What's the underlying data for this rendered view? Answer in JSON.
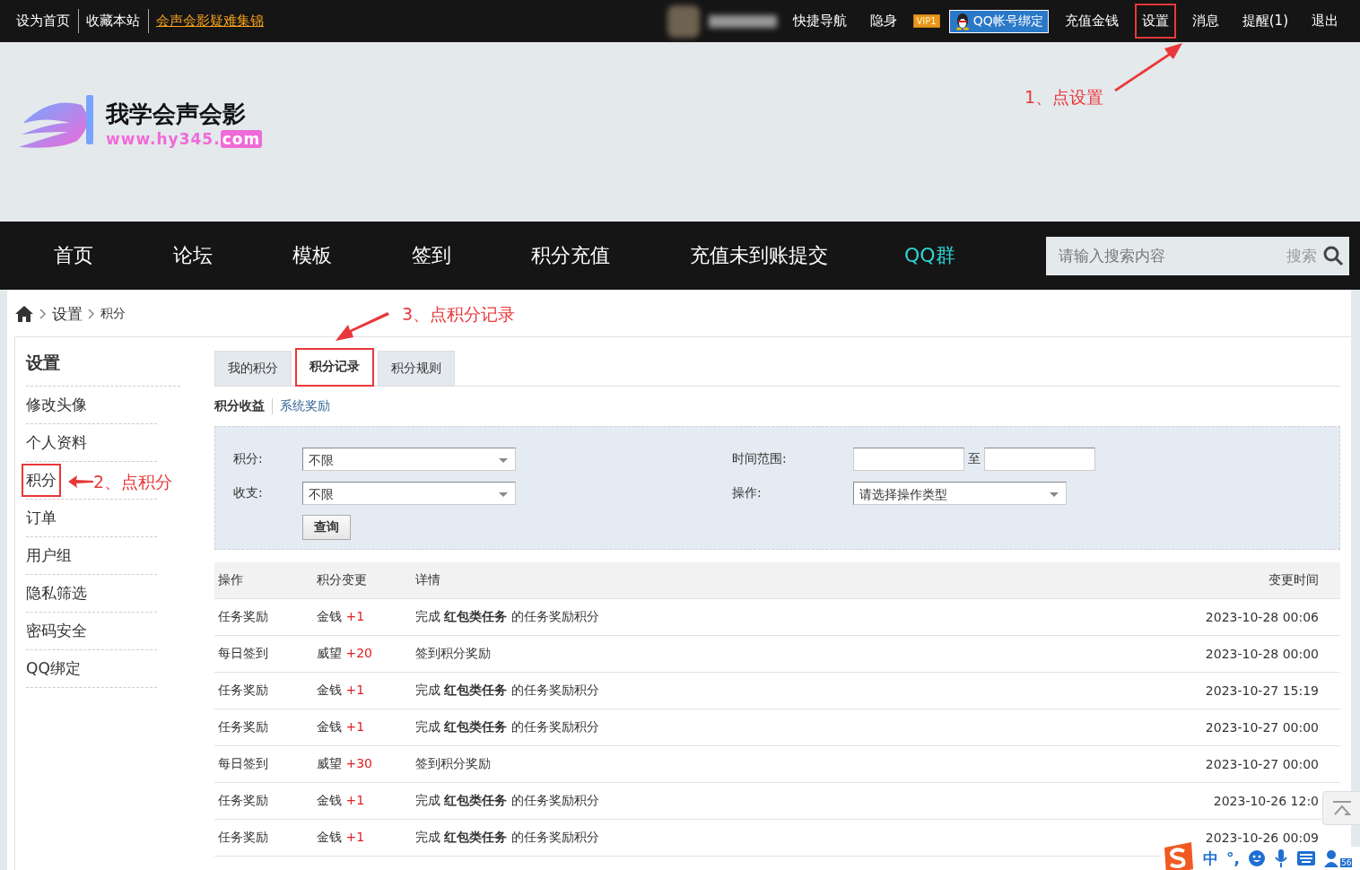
{
  "top_bar": {
    "left_links": [
      {
        "label": "设为首页",
        "kind": "plain"
      },
      {
        "label": "收藏本站",
        "kind": "plain"
      },
      {
        "label": "会声会影疑难集锦",
        "kind": "link"
      }
    ],
    "right_links": [
      {
        "label": "快捷导航",
        "kind": "text",
        "highlighted": false
      },
      {
        "label": "隐身",
        "kind": "text",
        "highlighted": false
      },
      {
        "label": "VIP1",
        "kind": "vip",
        "highlighted": false
      },
      {
        "label": "QQ帐号绑定",
        "kind": "qq",
        "highlighted": false
      },
      {
        "label": "充值金钱",
        "kind": "text",
        "highlighted": false
      },
      {
        "label": "设置",
        "kind": "text",
        "highlighted": true
      },
      {
        "label": "消息",
        "kind": "text",
        "highlighted": false
      },
      {
        "label": "提醒(1)",
        "kind": "text",
        "highlighted": false
      },
      {
        "label": "退出",
        "kind": "text",
        "highlighted": false
      }
    ]
  },
  "logo": {
    "title": "我学会声会影",
    "domain": "www.hy345.",
    "tld": "com"
  },
  "nav": {
    "items": [
      {
        "label": "首页",
        "accent": false
      },
      {
        "label": "论坛",
        "accent": false
      },
      {
        "label": "模板",
        "accent": false
      },
      {
        "label": "签到",
        "accent": false
      },
      {
        "label": "积分充值",
        "accent": false
      },
      {
        "label": "充值未到账提交",
        "accent": false
      },
      {
        "label": "QQ群",
        "accent": true
      }
    ],
    "search": {
      "placeholder": "请输入搜索内容",
      "button": "搜索"
    }
  },
  "breadcrumb": [
    "设置",
    "积分"
  ],
  "sidebar": {
    "title": "设置",
    "items": [
      {
        "label": "修改头像",
        "highlighted": false
      },
      {
        "label": "个人资料",
        "highlighted": false
      },
      {
        "label": "积分",
        "highlighted": true
      },
      {
        "label": "订单",
        "highlighted": false
      },
      {
        "label": "用户组",
        "highlighted": false
      },
      {
        "label": "隐私筛选",
        "highlighted": false
      },
      {
        "label": "密码安全",
        "highlighted": false
      },
      {
        "label": "QQ绑定",
        "highlighted": false
      }
    ]
  },
  "tabs": [
    {
      "label": "我的积分",
      "selected": false,
      "highlighted": false
    },
    {
      "label": "积分记录",
      "selected": true,
      "highlighted": true
    },
    {
      "label": "积分规则",
      "selected": false,
      "highlighted": false
    }
  ],
  "subtabs": [
    {
      "label": "积分收益",
      "selected": true
    },
    {
      "label": "系统奖励",
      "selected": false
    }
  ],
  "filters": {
    "credit_label": "积分:",
    "credit_value": "不限",
    "flow_label": "收支:",
    "flow_value": "不限",
    "time_label": "时间范围:",
    "time_sep": "至",
    "op_label": "操作:",
    "op_placeholder": "请选择操作类型",
    "submit": "查询"
  },
  "table": {
    "columns": [
      "操作",
      "积分变更",
      "详情",
      "变更时间"
    ],
    "rows": [
      {
        "op": "任务奖励",
        "unit": "金钱",
        "amount": "+1",
        "detail": "完成 **红包类任务** 的任务奖励积分",
        "time": "2023-10-28 00:06"
      },
      {
        "op": "每日签到",
        "unit": "威望",
        "amount": "+20",
        "detail": "签到积分奖励",
        "time": "2023-10-28 00:00"
      },
      {
        "op": "任务奖励",
        "unit": "金钱",
        "amount": "+1",
        "detail": "完成 **红包类任务** 的任务奖励积分",
        "time": "2023-10-27 15:19"
      },
      {
        "op": "任务奖励",
        "unit": "金钱",
        "amount": "+1",
        "detail": "完成 **红包类任务** 的任务奖励积分",
        "time": "2023-10-27 00:00"
      },
      {
        "op": "每日签到",
        "unit": "威望",
        "amount": "+30",
        "detail": "签到积分奖励",
        "time": "2023-10-27 00:00"
      },
      {
        "op": "任务奖励",
        "unit": "金钱",
        "amount": "+1",
        "detail": "完成 **红包类任务** 的任务奖励积分",
        "time": "2023-10-26 12:0"
      },
      {
        "op": "任务奖励",
        "unit": "金钱",
        "amount": "+1",
        "detail": "完成 **红包类任务** 的任务奖励积分",
        "time": "2023-10-26 00:09"
      }
    ]
  },
  "annotations": [
    "1、点设置",
    "2、点积分",
    "3、点积分记录"
  ],
  "ime_toolbar": {
    "mode": "中",
    "punctuation": "°,",
    "badge": "56"
  }
}
